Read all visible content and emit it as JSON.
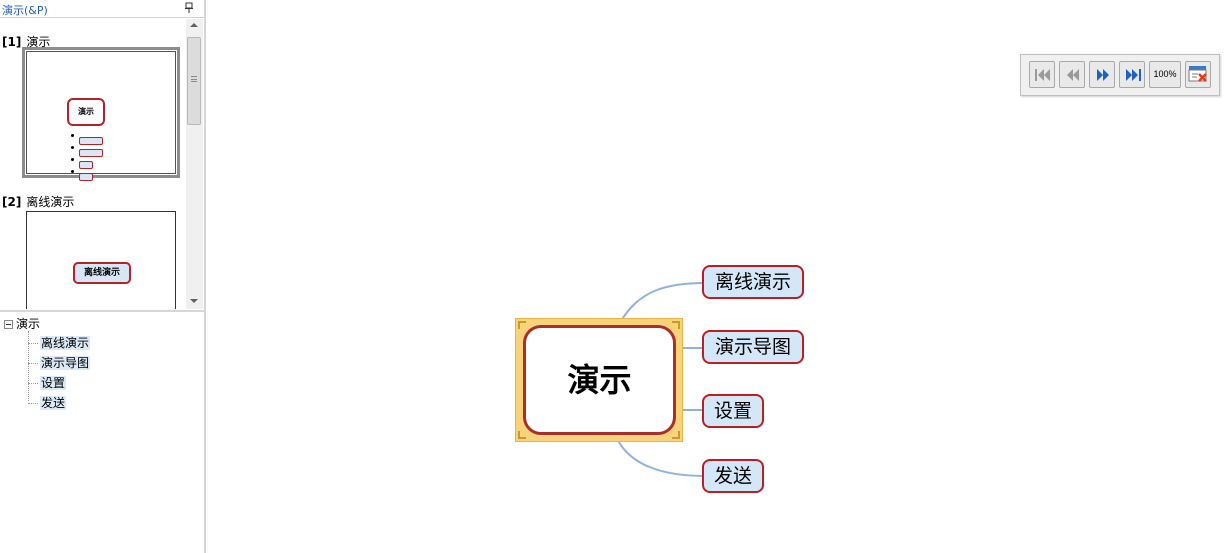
{
  "panel": {
    "title": "演示(&P)",
    "slides": [
      {
        "index": "[1]",
        "title": "演示"
      },
      {
        "index": "[2]",
        "title": "离线演示"
      }
    ],
    "thumb1": {
      "root_label": "演示"
    },
    "thumb2": {
      "topic_label": "离线演示"
    }
  },
  "tree": {
    "root": "演示",
    "items": [
      "离线演示",
      "演示导图",
      "设置",
      "发送"
    ]
  },
  "toolbar": {
    "zoom_label": "100%"
  },
  "mindmap": {
    "central": "演示",
    "topics": [
      "离线演示",
      "演示导图",
      "设置",
      "发送"
    ]
  },
  "colors": {
    "node_border": "#b82024",
    "node_fill": "#d4e7f8",
    "connector": "#8db3dd",
    "selection": "#f9d27c"
  }
}
